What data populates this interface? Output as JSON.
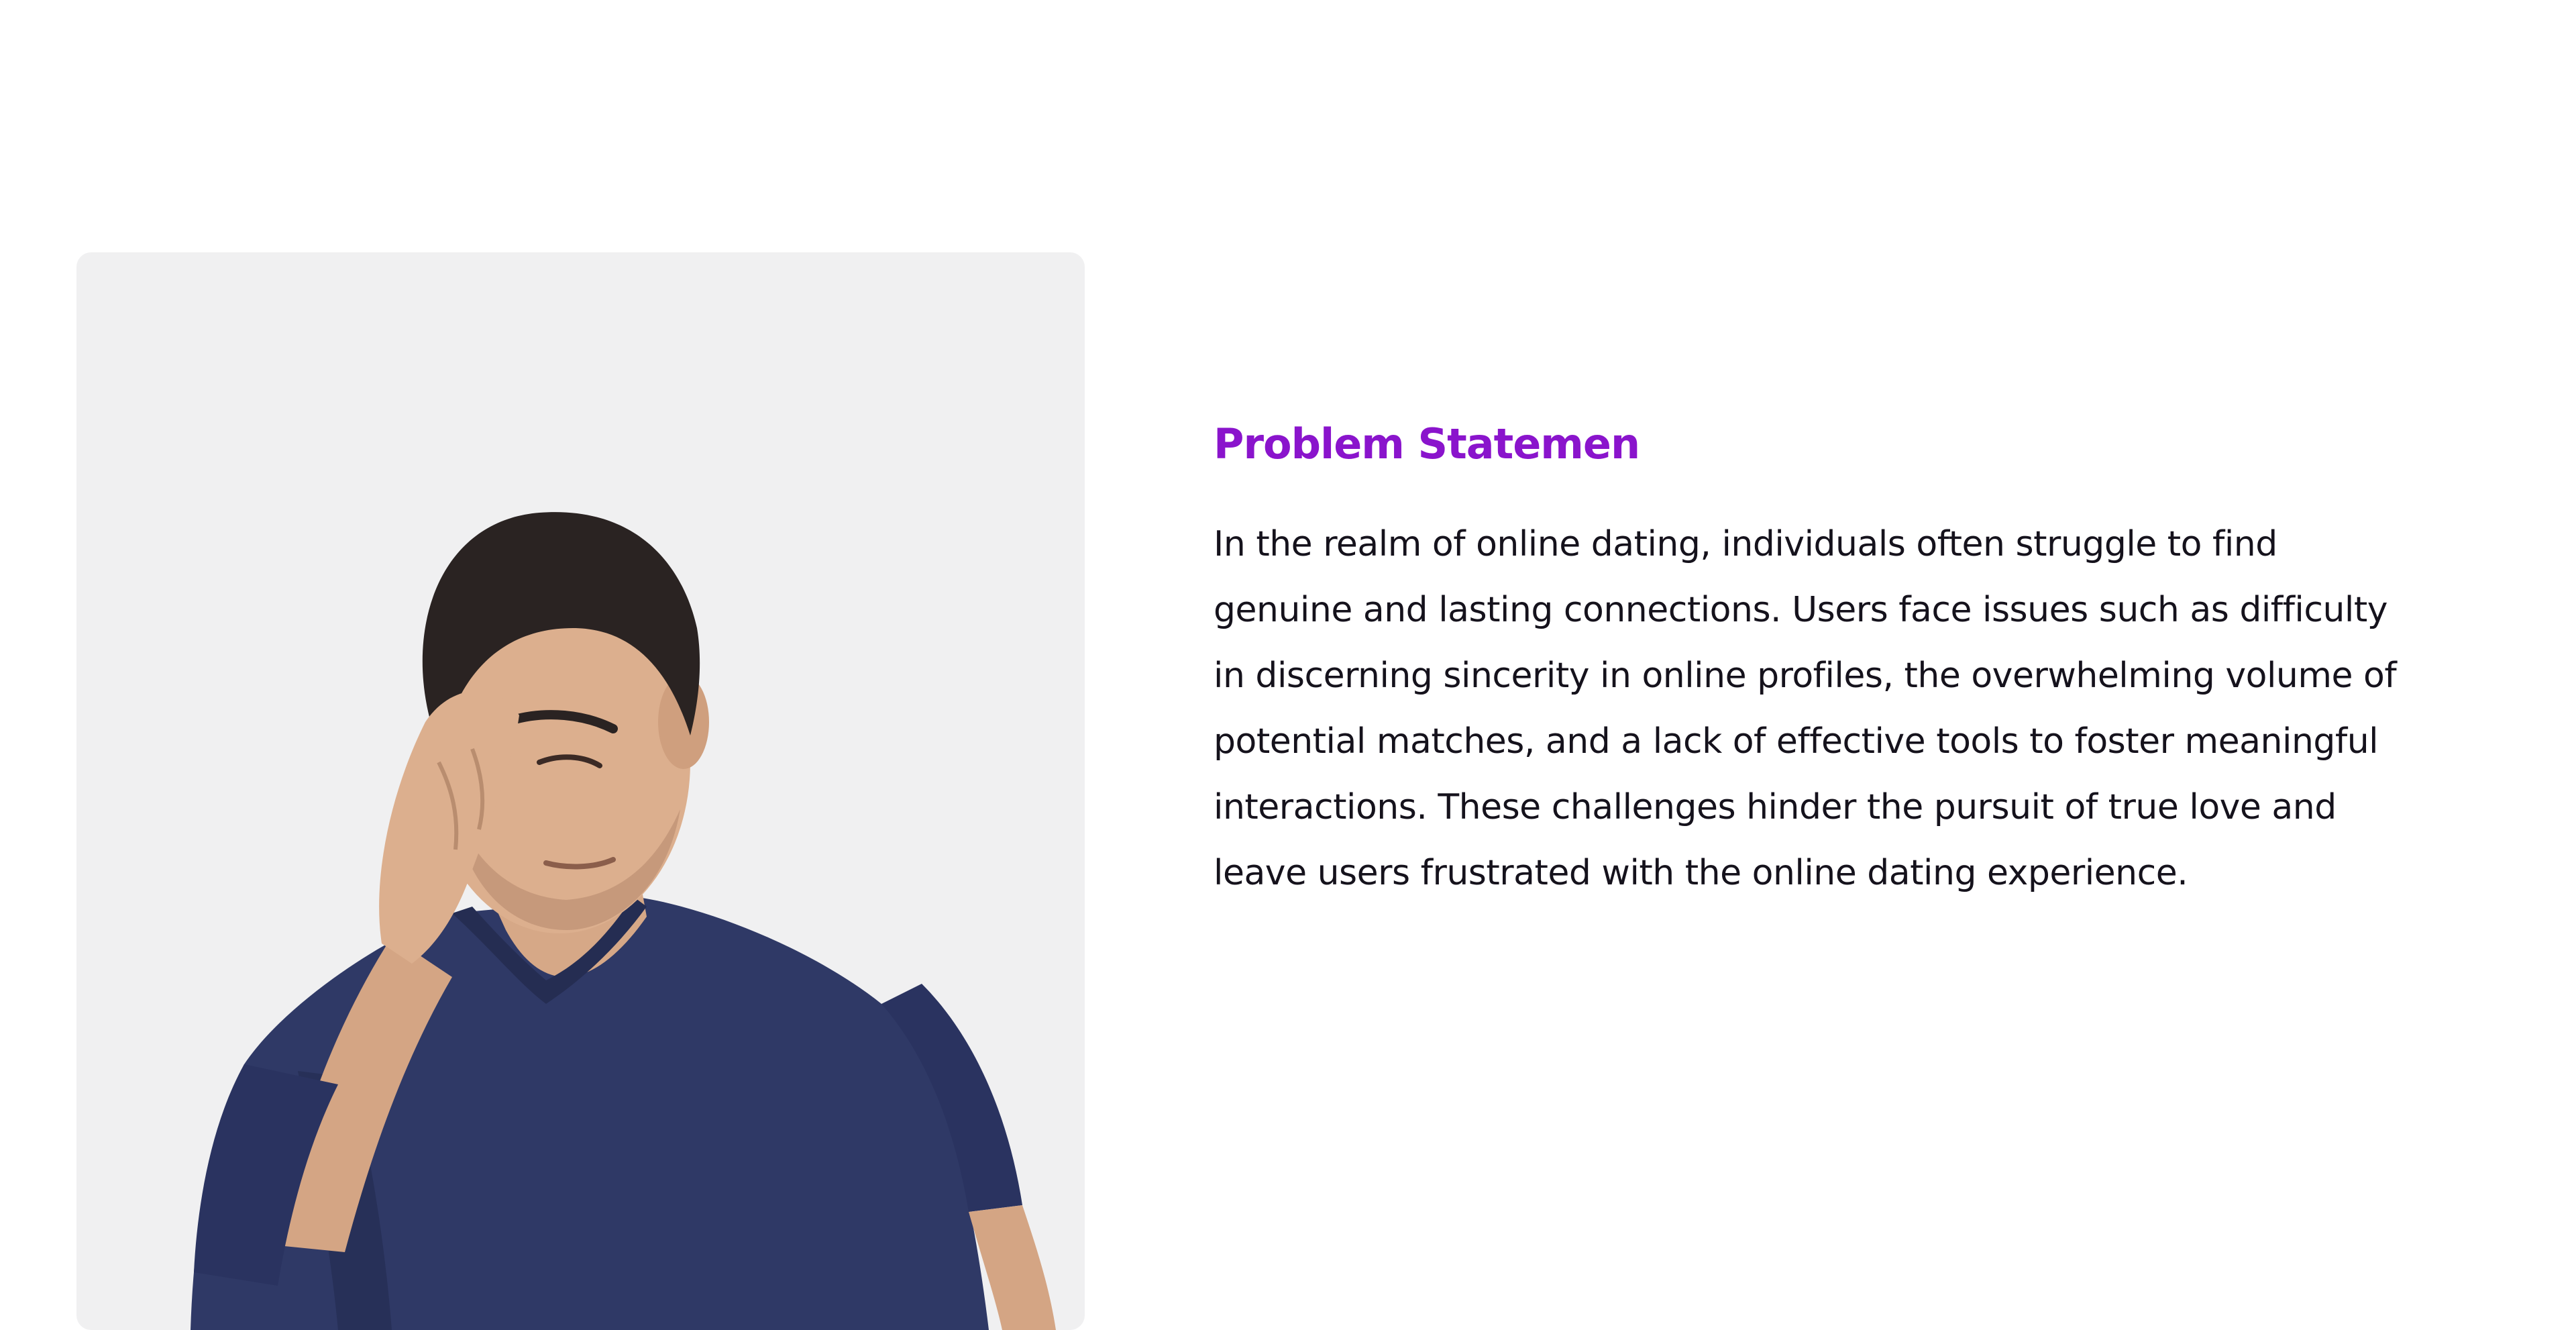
{
  "problem_section": {
    "heading": "Problem Statemen",
    "body": "In the realm of online dating, individuals often struggle to find genuine and lasting connections. Users face issues such as difficulty in discerning sincerity in online profiles, the overwhelming volume of potential matches, and a lack of effective tools to foster meaningful interactions. These challenges hinder the pursuit of true love and leave users frustrated with the online dating experience."
  },
  "colors": {
    "heading": "#8a14cc",
    "body_text": "#15121c",
    "card_background": "#f0f0f1",
    "shirt": "#2f3966"
  }
}
